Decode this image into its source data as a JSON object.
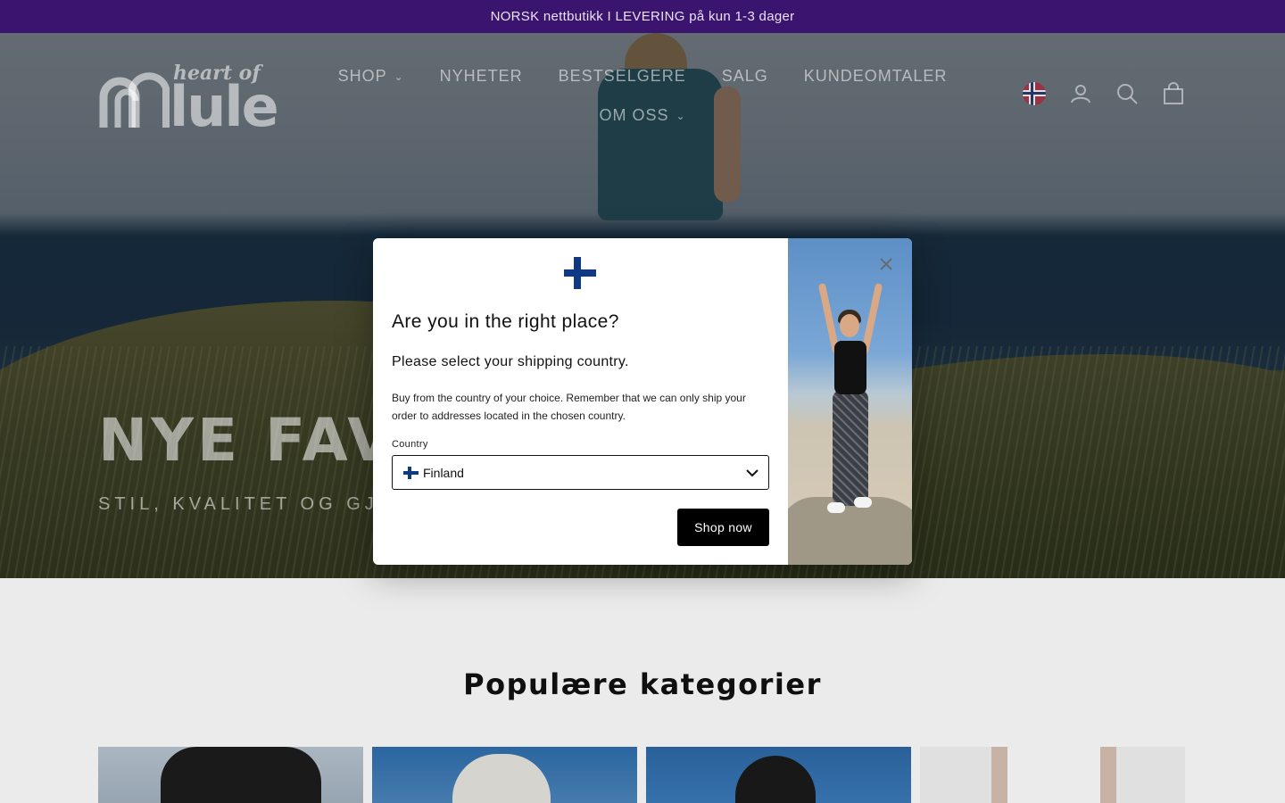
{
  "announcement": {
    "text": "NORSK nettbutikk I LEVERING på kun 1-3 dager"
  },
  "logo": {
    "small": "heart of",
    "big": "lule"
  },
  "nav": {
    "items": [
      {
        "label": "SHOP",
        "has_dropdown": true
      },
      {
        "label": "NYHETER",
        "has_dropdown": false
      },
      {
        "label": "BESTSELGERE",
        "has_dropdown": false
      },
      {
        "label": "SALG",
        "has_dropdown": false
      },
      {
        "label": "KUNDEOMTALER",
        "has_dropdown": false
      },
      {
        "label": "OM OSS",
        "has_dropdown": true
      }
    ]
  },
  "header_icons": [
    "norway-flag-icon",
    "account-icon",
    "search-icon",
    "cart-icon"
  ],
  "hero": {
    "title": "NYE FAV",
    "subtitle": "STIL, KVALITET OG GJEN"
  },
  "section": {
    "title": "Populære kategorier"
  },
  "modal": {
    "flag_icon": "finland-flag-icon",
    "title": "Are you in the right place?",
    "subtitle": "Please select your shipping country.",
    "description": "Buy from the country of your choice. Remember that we can only ship your order to addresses located in the chosen country.",
    "country_label": "Country",
    "country_value": "Finland",
    "button_label": "Shop now",
    "close_icon": "close-icon"
  },
  "colors": {
    "announcement_bg": "#3b1470",
    "modal_button_bg": "#000000",
    "finland_blue": "#0f3a83"
  }
}
